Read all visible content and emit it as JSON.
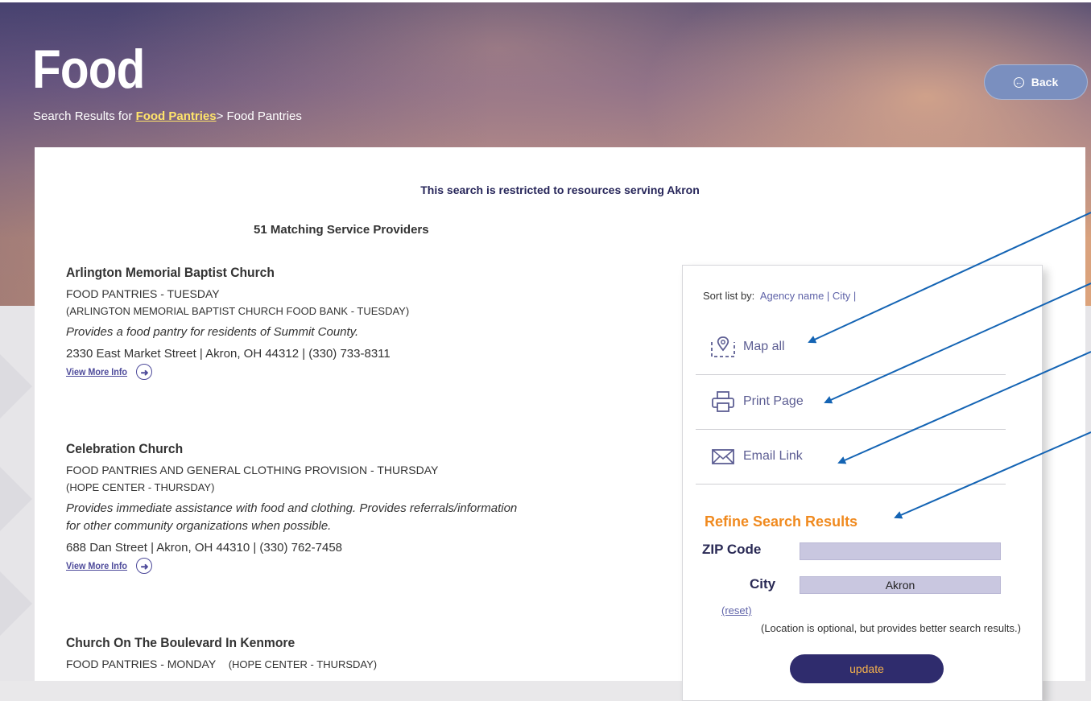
{
  "header": {
    "title": "Food",
    "breadcrumb_prefix": "Search Results for ",
    "breadcrumb_link": "Food Pantries",
    "breadcrumb_suffix": "> Food Pantries",
    "back_label": "Back"
  },
  "main": {
    "restriction_note": "This search is restricted to resources serving Akron",
    "match_count": "51 Matching Service Providers",
    "results": [
      {
        "name": "Arlington Memorial Baptist Church",
        "service": "FOOD PANTRIES - TUESDAY",
        "agency": "(ARLINGTON MEMORIAL BAPTIST CHURCH FOOD BANK - TUESDAY)",
        "description": "Provides a food pantry for residents of Summit County.",
        "address": "2330 East Market Street | Akron, OH 44312 | (330) 733-8311",
        "more_label": "View More Info"
      },
      {
        "name": "Celebration Church",
        "service": "FOOD PANTRIES AND GENERAL CLOTHING PROVISION - THURSDAY",
        "agency": "(HOPE CENTER - THURSDAY)",
        "description_line1": "Provides immediate assistance with food and clothing. Provides referrals/information",
        "description_line2": "for other community organizations when possible.",
        "address": "688 Dan Street | Akron, OH 44310 | (330) 762-7458",
        "more_label": "View More Info"
      },
      {
        "name": "Church On The Boulevard In Kenmore",
        "service": "FOOD PANTRIES - MONDAY",
        "agency": "(HOPE CENTER - THURSDAY)"
      }
    ]
  },
  "sidebar": {
    "sort_label": "Sort list by:",
    "sort_agency": "Agency name",
    "sort_sep1": " | ",
    "sort_city": "City",
    "sort_sep2": " |",
    "map_all": "Map all",
    "print_page": "Print Page",
    "email_link": "Email Link",
    "refine_title": "Refine Search Results",
    "zip_label": "ZIP Code",
    "zip_value": "",
    "city_label": "City",
    "city_value": "Akron",
    "reset_label": "(reset)",
    "optional_note": "(Location is optional, but provides better search results.)",
    "update_label": "update"
  },
  "colors": {
    "accent_orange": "#f08a1f",
    "link_purple": "#5f63a8",
    "navy": "#2f2c6d",
    "annotation_blue": "#1464b4"
  }
}
